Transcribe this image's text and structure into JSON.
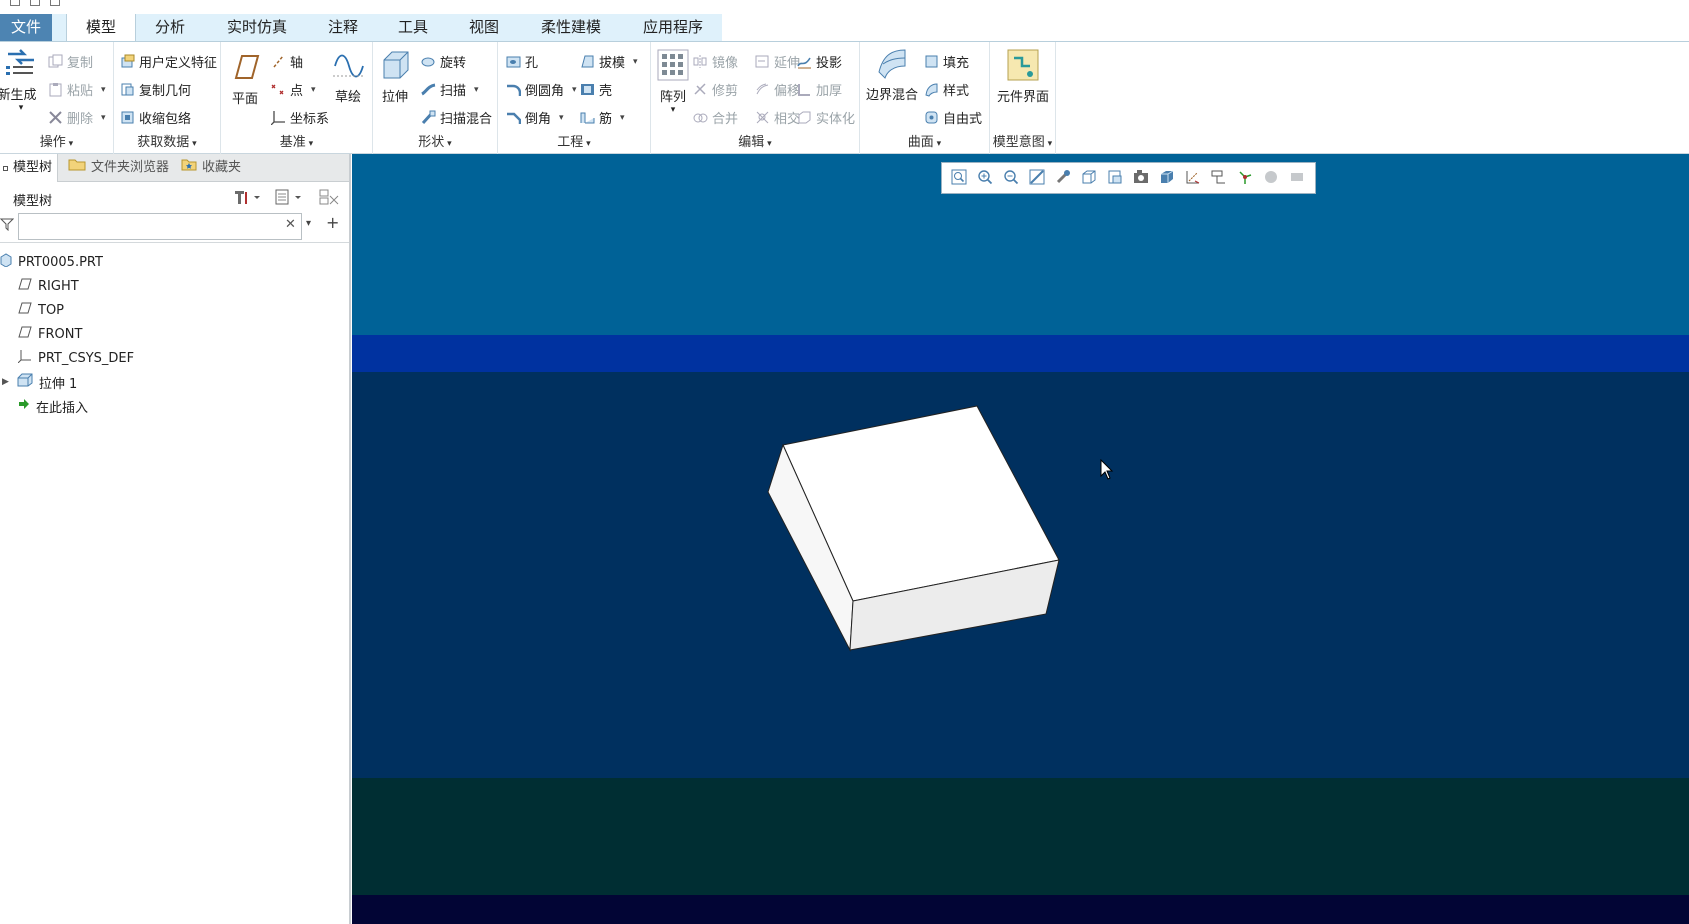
{
  "tabs": {
    "file": "文件",
    "model": "模型",
    "analysis": "分析",
    "simulation": "实时仿真",
    "annotate": "注释",
    "tools": "工具",
    "view": "视图",
    "flex": "柔性建模",
    "apps": "应用程序"
  },
  "ribbon": {
    "operations": {
      "label": "操作",
      "regenerate": "新生成",
      "copy": "复制",
      "paste": "粘贴",
      "delete": "删除"
    },
    "getdata": {
      "label": "获取数据",
      "udf": "用户定义特征",
      "copygeom": "复制几何",
      "shrinkwrap": "收缩包络"
    },
    "datum": {
      "label": "基准",
      "plane": "平面",
      "axis": "轴",
      "point": "点",
      "csys": "坐标系",
      "sketch": "草绘"
    },
    "shapes": {
      "label": "形状",
      "extrude": "拉伸",
      "revolve": "旋转",
      "sweep": "扫描",
      "sweepblend": "扫描混合"
    },
    "engineering": {
      "label": "工程",
      "hole": "孔",
      "round": "倒圆角",
      "chamfer": "倒角",
      "draft": "拔模",
      "shell": "壳",
      "rib": "筋"
    },
    "editing": {
      "label": "编辑",
      "pattern": "阵列",
      "mirror": "镜像",
      "trim": "修剪",
      "merge": "合并",
      "extend": "延伸",
      "offset": "偏移",
      "intersect": "相交",
      "project": "投影",
      "thicken": "加厚",
      "solidify": "实体化"
    },
    "surfaces": {
      "label": "曲面",
      "boundary": "边界混合",
      "fill": "填充",
      "style": "样式",
      "freestyle": "自由式"
    },
    "intent": {
      "label": "模型意图",
      "component": "元件界面"
    }
  },
  "panel": {
    "tabs": {
      "modeltree": "模型树",
      "folder": "文件夹浏览器",
      "favorites": "收藏夹"
    },
    "tree_title": "模型树",
    "filter_value": "",
    "items": [
      {
        "label": "PRT0005.PRT",
        "icon": "part-icon"
      },
      {
        "label": "RIGHT",
        "icon": "datum-plane-icon"
      },
      {
        "label": "TOP",
        "icon": "datum-plane-icon"
      },
      {
        "label": "FRONT",
        "icon": "datum-plane-icon"
      },
      {
        "label": "PRT_CSYS_DEF",
        "icon": "csys-icon"
      },
      {
        "label": "拉伸 1",
        "icon": "extrude-icon"
      },
      {
        "label": "在此插入",
        "icon": "insert-arrow-icon"
      }
    ]
  },
  "colors": {
    "accent": "#4d84b2",
    "viewport_top": "#006297",
    "viewport_band": "#0032a0",
    "viewport_main": "#00305f",
    "viewport_lower": "#002e33",
    "viewport_bottom": "#020535",
    "model_face": "#ffffff"
  }
}
